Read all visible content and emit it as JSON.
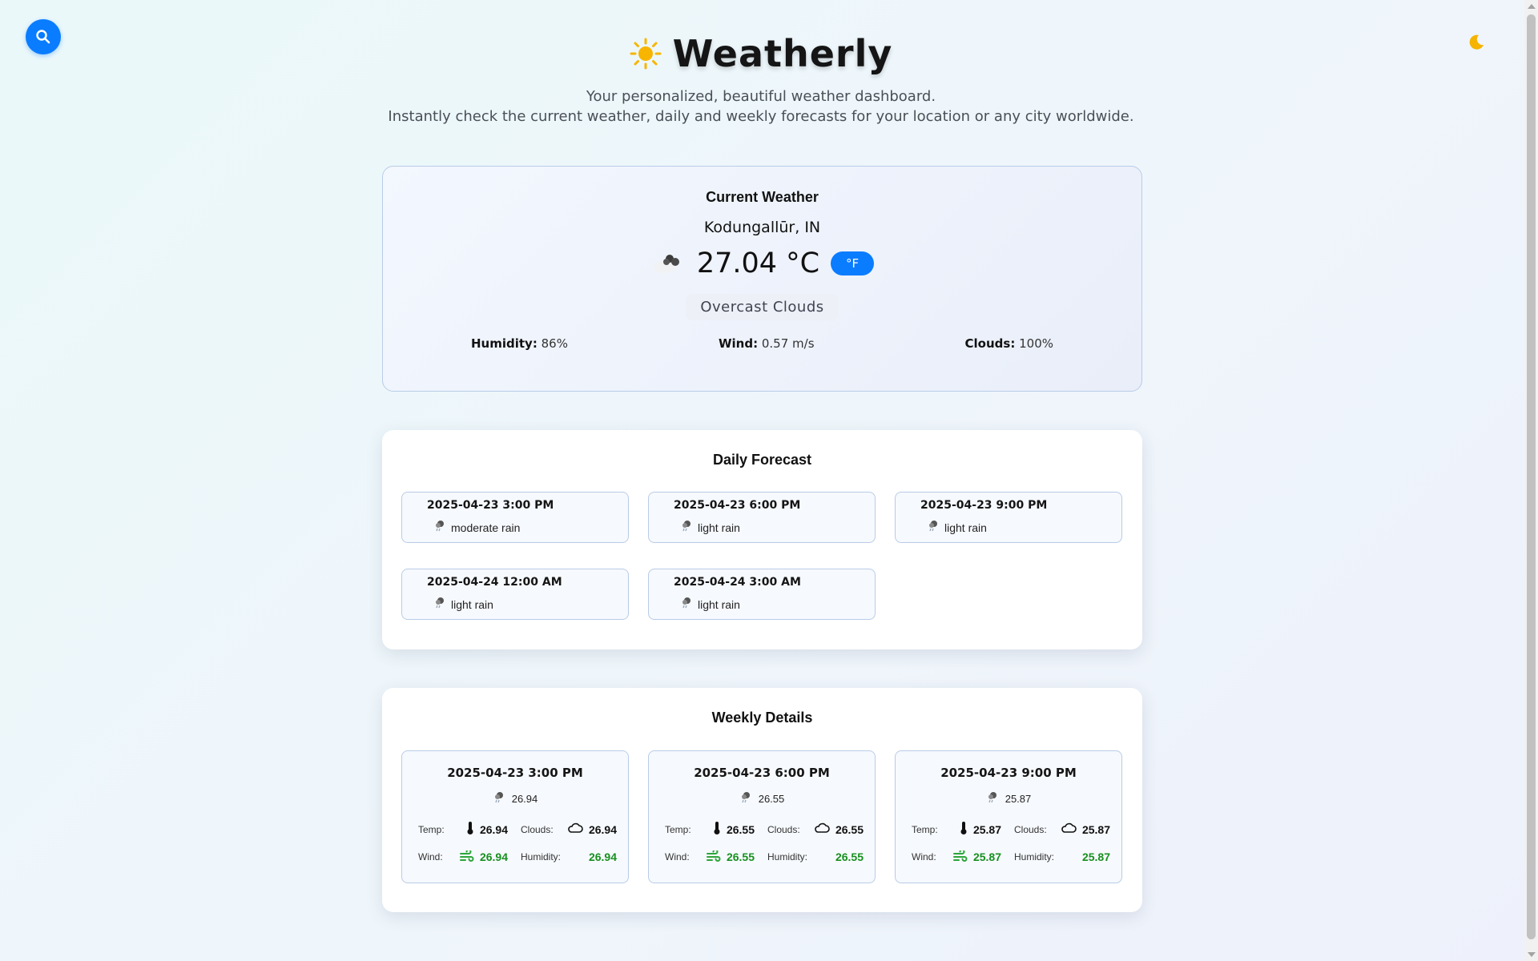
{
  "app": {
    "title": "Weatherly",
    "subtitle_line1": "Your personalized, beautiful weather dashboard.",
    "subtitle_line2": "Instantly check the current weather, daily and weekly forecasts for your location or any city worldwide.",
    "title_icon": "sun-icon",
    "theme_toggle_icon": "moon-icon",
    "search_icon": "search-icon"
  },
  "colors": {
    "accent": "#0a7cff",
    "sun": "#f7b500",
    "green": "#17901e",
    "card_border": "#b9cce8"
  },
  "current": {
    "heading": "Current Weather",
    "city": "Kodungallūr, IN",
    "temp": "27.04 °C",
    "unit_toggle": "°F",
    "condition": "Overcast Clouds",
    "icon": "overcast-clouds-icon",
    "humidity_label": "Humidity:",
    "humidity_value": "86%",
    "wind_label": "Wind:",
    "wind_value": "0.57 m/s",
    "clouds_label": "Clouds:",
    "clouds_value": "100%"
  },
  "daily": {
    "heading": "Daily Forecast",
    "items": [
      {
        "date": "2025-04-23 3:00 PM",
        "desc": "moderate rain",
        "icon": "rain-icon"
      },
      {
        "date": "2025-04-23 6:00 PM",
        "desc": "light rain",
        "icon": "rain-icon"
      },
      {
        "date": "2025-04-23 9:00 PM",
        "desc": "light rain",
        "icon": "rain-icon"
      },
      {
        "date": "2025-04-24 12:00 AM",
        "desc": "light rain",
        "icon": "rain-icon"
      },
      {
        "date": "2025-04-24 3:00 AM",
        "desc": "light rain",
        "icon": "rain-icon"
      }
    ]
  },
  "weekly": {
    "heading": "Weekly Details",
    "temp_label": "Temp:",
    "clouds_label": "Clouds:",
    "wind_label": "Wind:",
    "humidity_label": "Humidity:",
    "items": [
      {
        "date": "2025-04-23 3:00 PM",
        "summary": "26.94",
        "temp": "26.94",
        "clouds": "26.94",
        "wind": "26.94",
        "humidity": "26.94"
      },
      {
        "date": "2025-04-23 6:00 PM",
        "summary": "26.55",
        "temp": "26.55",
        "clouds": "26.55",
        "wind": "26.55",
        "humidity": "26.55"
      },
      {
        "date": "2025-04-23 9:00 PM",
        "summary": "25.87",
        "temp": "25.87",
        "clouds": "25.87",
        "wind": "25.87",
        "humidity": "25.87"
      }
    ]
  }
}
